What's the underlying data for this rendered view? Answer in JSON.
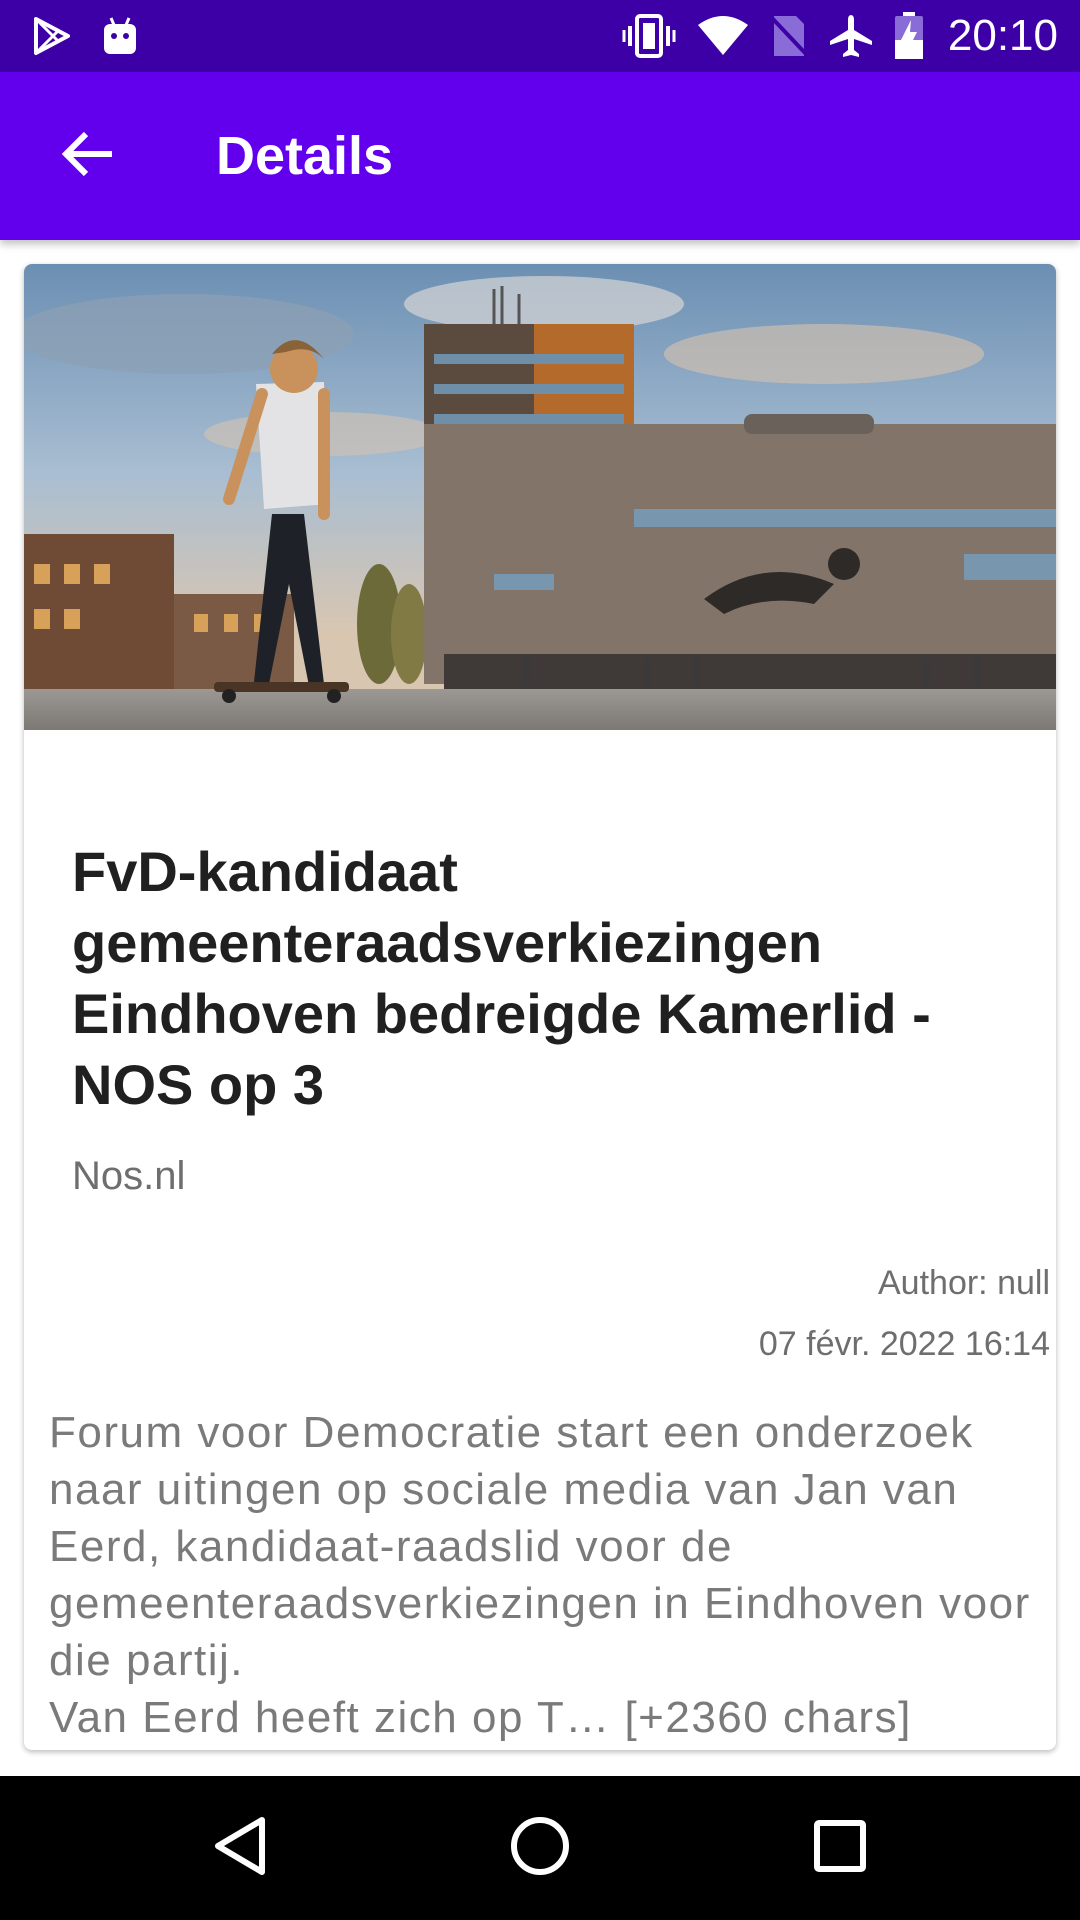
{
  "status_bar": {
    "time": "20:10",
    "left_icons": [
      "play-store-icon",
      "android-icon"
    ],
    "right_icons": [
      "vibrate-icon",
      "wifi-icon",
      "no-sim-icon",
      "airplane-mode-icon",
      "battery-charging-icon"
    ]
  },
  "app_bar": {
    "title": "Details",
    "back_icon": "arrow-back-icon"
  },
  "article": {
    "title": "FvD-kandidaat gemeenteraadsverkiezingen Eindhoven bedreigde Kamerlid - NOS op 3",
    "source": "Nos.nl",
    "author": "Author: null",
    "date": "07 févr. 2022 16:14",
    "description": "Forum voor Democratie start een onderzoek naar uitingen op sociale media van Jan van Eerd, kandidaat-raadslid voor de gemeenteraadsverkiezingen in Eindhoven voor die partij.\nVan Eerd heeft zich op T… [+2360 chars]"
  },
  "nav_bar": {
    "buttons": [
      "back-triangle-icon",
      "home-circle-icon",
      "recents-square-icon"
    ]
  },
  "colors": {
    "status_bar": "#3d00a6",
    "app_bar": "#6200ee",
    "title_text": "#202020",
    "secondary_text": "#6e6e6e"
  }
}
